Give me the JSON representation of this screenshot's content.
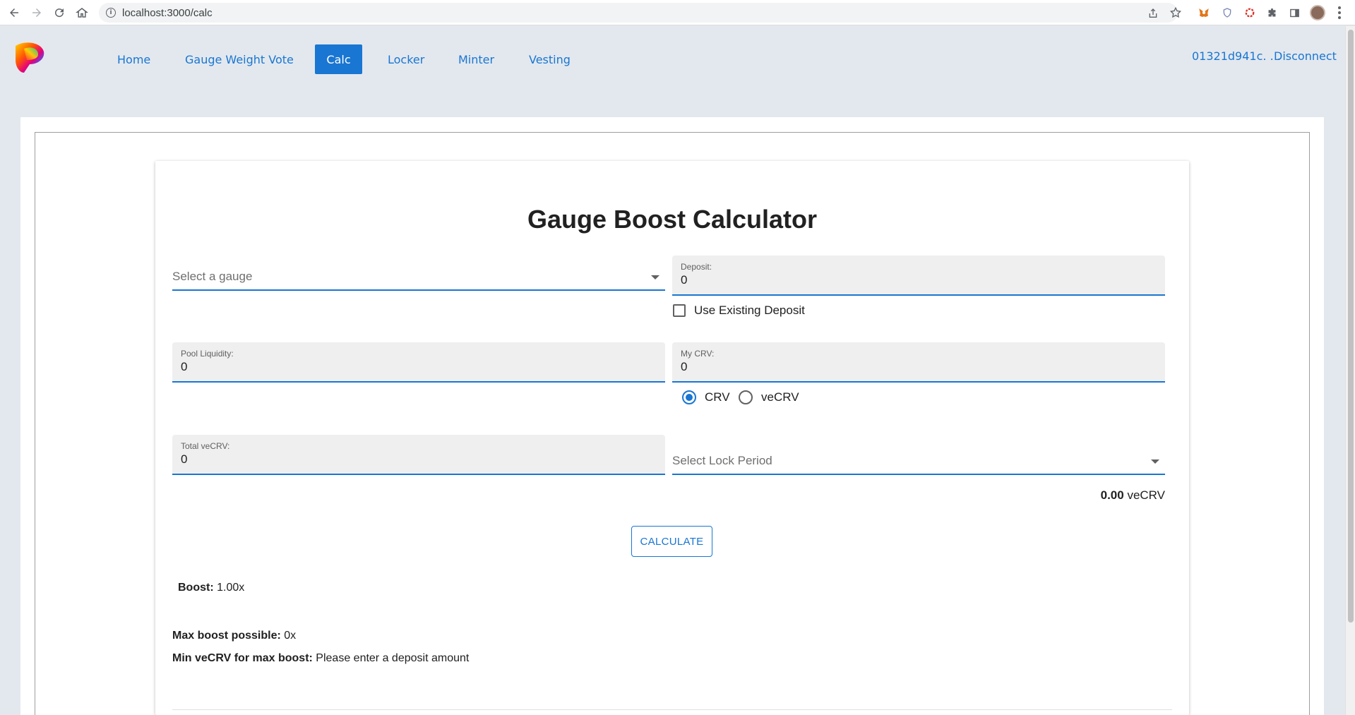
{
  "browser": {
    "url": "localhost:3000/calc"
  },
  "nav": {
    "items": [
      {
        "label": "Home",
        "active": false
      },
      {
        "label": "Gauge Weight Vote",
        "active": false
      },
      {
        "label": "Calc",
        "active": true
      },
      {
        "label": "Locker",
        "active": false
      },
      {
        "label": "Minter",
        "active": false
      },
      {
        "label": "Vesting",
        "active": false
      }
    ],
    "wallet_address": "01321d941c. . .",
    "disconnect_label": "Disconnect"
  },
  "calculator": {
    "title": "Gauge Boost Calculator",
    "gauge_select_placeholder": "Select a gauge",
    "deposit": {
      "label": "Deposit:",
      "value": "0"
    },
    "use_existing_deposit_label": "Use Existing Deposit",
    "use_existing_deposit_checked": false,
    "pool_liquidity": {
      "label": "Pool Liquidity:",
      "value": "0"
    },
    "my_crv": {
      "label": "My CRV:",
      "value": "0"
    },
    "token_options": [
      {
        "label": "CRV",
        "checked": true
      },
      {
        "label": "veCRV",
        "checked": false
      }
    ],
    "total_vecrv": {
      "label": "Total veCRV:",
      "value": "0"
    },
    "lock_period_placeholder": "Select Lock Period",
    "vecrv_amount": "0.00",
    "vecrv_unit": "veCRV",
    "calculate_label": "CALCULATE"
  },
  "results": {
    "boost_label": "Boost:",
    "boost_value": "1.00x",
    "max_boost_label": "Max boost possible:",
    "max_boost_value": "0x",
    "min_vecrv_label": "Min veCRV for max boost:",
    "min_vecrv_value": "Please enter a deposit amount"
  },
  "colors": {
    "accent": "#1976d2",
    "page_background": "#e3e8ee"
  }
}
